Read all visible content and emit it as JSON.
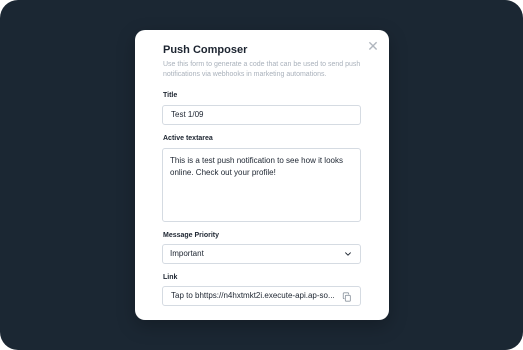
{
  "modal": {
    "title": "Push Composer",
    "subtitle": "Use this form to generate a code that can be used to send push notifications via webhooks in marketing automations.",
    "close_icon": "close-icon"
  },
  "fields": {
    "title": {
      "label": "Title",
      "value": "Test 1/09"
    },
    "active_textarea": {
      "label": "Active textarea",
      "value": "This is a test push notification to see how it looks online. Check out your profile!"
    },
    "message_priority": {
      "label": "Message Priority",
      "value": "Important"
    },
    "link": {
      "label": "Link",
      "value": "Tap to bhttps://n4hxtmkt2i.execute-api.ap-so..."
    }
  },
  "icons": {
    "dropdown": "chevron-down-icon",
    "copy": "copy-icon"
  },
  "colors": {
    "background": "#1b2733",
    "modal": "#ffffff",
    "text": "#1c2430",
    "muted": "#a9b1bb",
    "border": "#d5dbe2"
  }
}
